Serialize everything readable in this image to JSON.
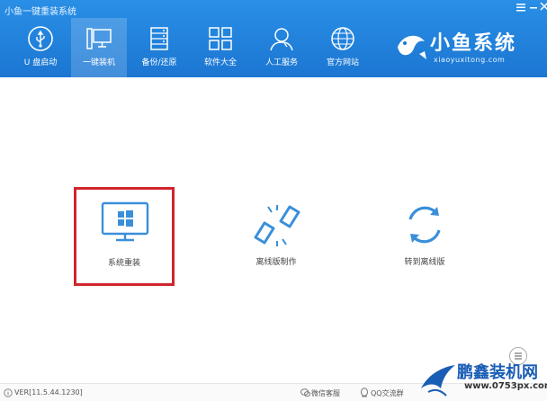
{
  "window": {
    "title": "小鱼一键重装系统",
    "menu_icon": "menu-icon",
    "min_icon": "minimize-icon",
    "close_icon": "close-icon"
  },
  "nav": {
    "tabs": [
      {
        "label": "U 盘启动",
        "icon": "usb-icon",
        "active": false
      },
      {
        "label": "一键装机",
        "icon": "monitor-icon",
        "active": true
      },
      {
        "label": "备份/还原",
        "icon": "backup-icon",
        "active": false
      },
      {
        "label": "软件大全",
        "icon": "grid-icon",
        "active": false
      },
      {
        "label": "人工服务",
        "icon": "support-icon",
        "active": false
      },
      {
        "label": "官方网站",
        "icon": "globe-icon",
        "active": false
      }
    ]
  },
  "brand": {
    "name": "小鱼系统",
    "url": "xiaoyuxitong.com"
  },
  "features": [
    {
      "label": "系统重装",
      "icon": "windows-monitor-icon",
      "selected": true
    },
    {
      "label": "离线版制作",
      "icon": "link-broken-icon",
      "selected": false
    },
    {
      "label": "转到离线版",
      "icon": "refresh-icon",
      "selected": false
    }
  ],
  "footer": {
    "version": "VER[11.5.44.1230]",
    "wechat": "微信客服",
    "qq": "QQ交流群"
  },
  "watermark": {
    "name": "鹏鑫装机网",
    "url": "www.0753px.com"
  },
  "colors": {
    "header_blue": "#1b76d2",
    "accent_blue": "#3a8fd9",
    "highlight_red": "#d0262c"
  }
}
